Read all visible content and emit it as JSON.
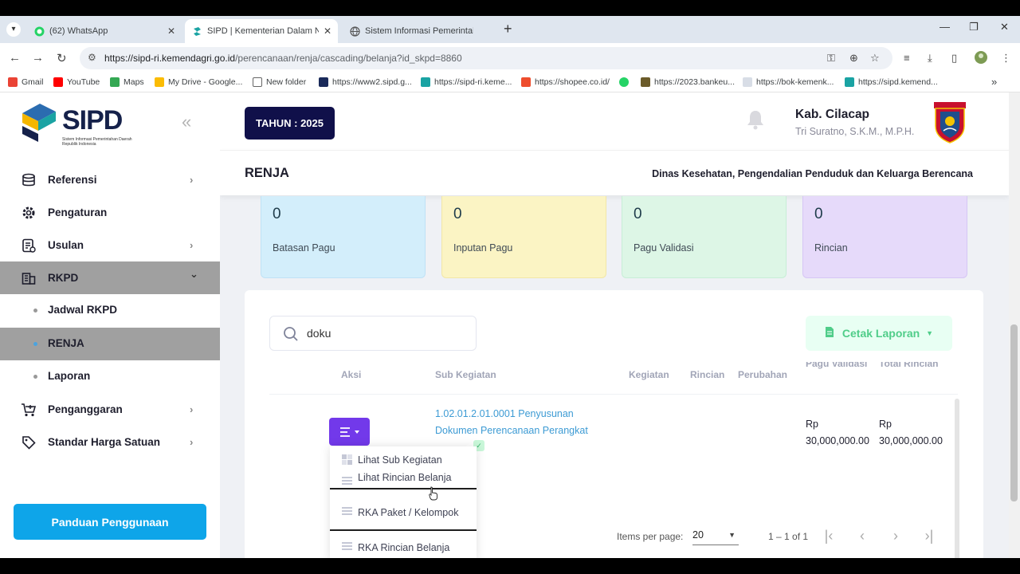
{
  "browser": {
    "tabs": [
      {
        "title": "(62) WhatsApp",
        "close": "✕"
      },
      {
        "title": "SIPD | Kementerian Dalam Negeri",
        "close": "✕"
      },
      {
        "title": "Sistem Informasi Pemerintahan Daerah"
      }
    ],
    "new_tab": "+",
    "url_main": "https://sipd-ri.kemendagri.go.id",
    "url_path": "/perencanaan/renja/cascading/belanja?id_skpd=8860",
    "bookmarks": [
      {
        "label": "Gmail",
        "color": "#ea4335"
      },
      {
        "label": "YouTube",
        "color": "#ff0000"
      },
      {
        "label": "Maps",
        "color": "#34a853"
      },
      {
        "label": "My Drive - Google...",
        "color": "#fbbc04"
      },
      {
        "label": "New folder",
        "color": "#666666"
      },
      {
        "label": "https://www2.sipd.g...",
        "color": "#1a2a5a"
      },
      {
        "label": "https://sipd-ri.keme...",
        "color": "#1aa3a3"
      },
      {
        "label": "https://shopee.co.id/",
        "color": "#ee4d2d"
      },
      {
        "label": "",
        "color": "#25d366"
      },
      {
        "label": "https://2023.bankeu...",
        "color": "#6b5b2a"
      },
      {
        "label": "https://bok-kemenk...",
        "color": "#7a8aa0"
      },
      {
        "label": "https://sipd.kemend...",
        "color": "#1aa3a3"
      }
    ]
  },
  "sidebar": {
    "logo_text": "SIPD",
    "logo_tagline": "Sistem Informasi Pemerintahan Daerah Republik Indonesia",
    "collapse_glyph": "«",
    "items": [
      {
        "label": "Referensi",
        "icon": "database-icon",
        "chevron": "›"
      },
      {
        "label": "Pengaturan",
        "icon": "gear-icon",
        "chevron": ""
      },
      {
        "label": "Usulan",
        "icon": "document-list-icon",
        "chevron": "›"
      },
      {
        "label": "RKPD",
        "icon": "building-icon",
        "chevron": "⌄"
      },
      {
        "label": "Penganggaran",
        "icon": "cart-icon",
        "chevron": "›"
      },
      {
        "label": "Standar Harga Satuan",
        "icon": "price-tag-icon",
        "chevron": "›"
      }
    ],
    "sub_items": [
      "Jadwal RKPD",
      "RENJA",
      "Laporan"
    ],
    "guide_button": "Panduan Penggunaan"
  },
  "header": {
    "year_badge": "TAHUN : 2025",
    "region": "Kab. Cilacap",
    "user": "Tri Suratno, S.K.M., M.P.H.",
    "page_title": "RENJA",
    "department": "Dinas Kesehatan, Pengendalian Penduduk dan Keluarga Berencana"
  },
  "stats": [
    {
      "value": "0",
      "label": "Batasan Pagu",
      "color": "#d3eefb"
    },
    {
      "value": "0",
      "label": "Inputan Pagu",
      "color": "#fbf4c4"
    },
    {
      "value": "0",
      "label": "Pagu Validasi",
      "color": "#ddf6e6"
    },
    {
      "value": "0",
      "label": "Rincian",
      "color": "#e6dafa"
    }
  ],
  "search": {
    "value": "doku"
  },
  "print_button": "Cetak Laporan",
  "table": {
    "headers": [
      "Aksi",
      "Sub Kegiatan",
      "Kegiatan",
      "Rincian",
      "Perubahan"
    ],
    "cut_headers": [
      "Pagu Validasi",
      "Total Rincian"
    ],
    "row": {
      "sub_kegiatan": "1.02.01.2.01.0001 Penyusunan Dokumen Perencanaan Perangkat",
      "check": "✓",
      "pagu_validasi_1": "Rp",
      "pagu_validasi_2": "30,000,000.00",
      "total_rincian_1": "Rp",
      "total_rincian_2": "30,000,000.00"
    }
  },
  "dropdown": [
    "Lihat Sub Kegiatan",
    "Lihat Rincian Belanja",
    "RKA Paket / Kelompok",
    "RKA Rincian Belanja"
  ],
  "pagination": {
    "items_per_page_label": "Items per page:",
    "items_per_page": "20",
    "range": "1 – 1 of 1"
  }
}
